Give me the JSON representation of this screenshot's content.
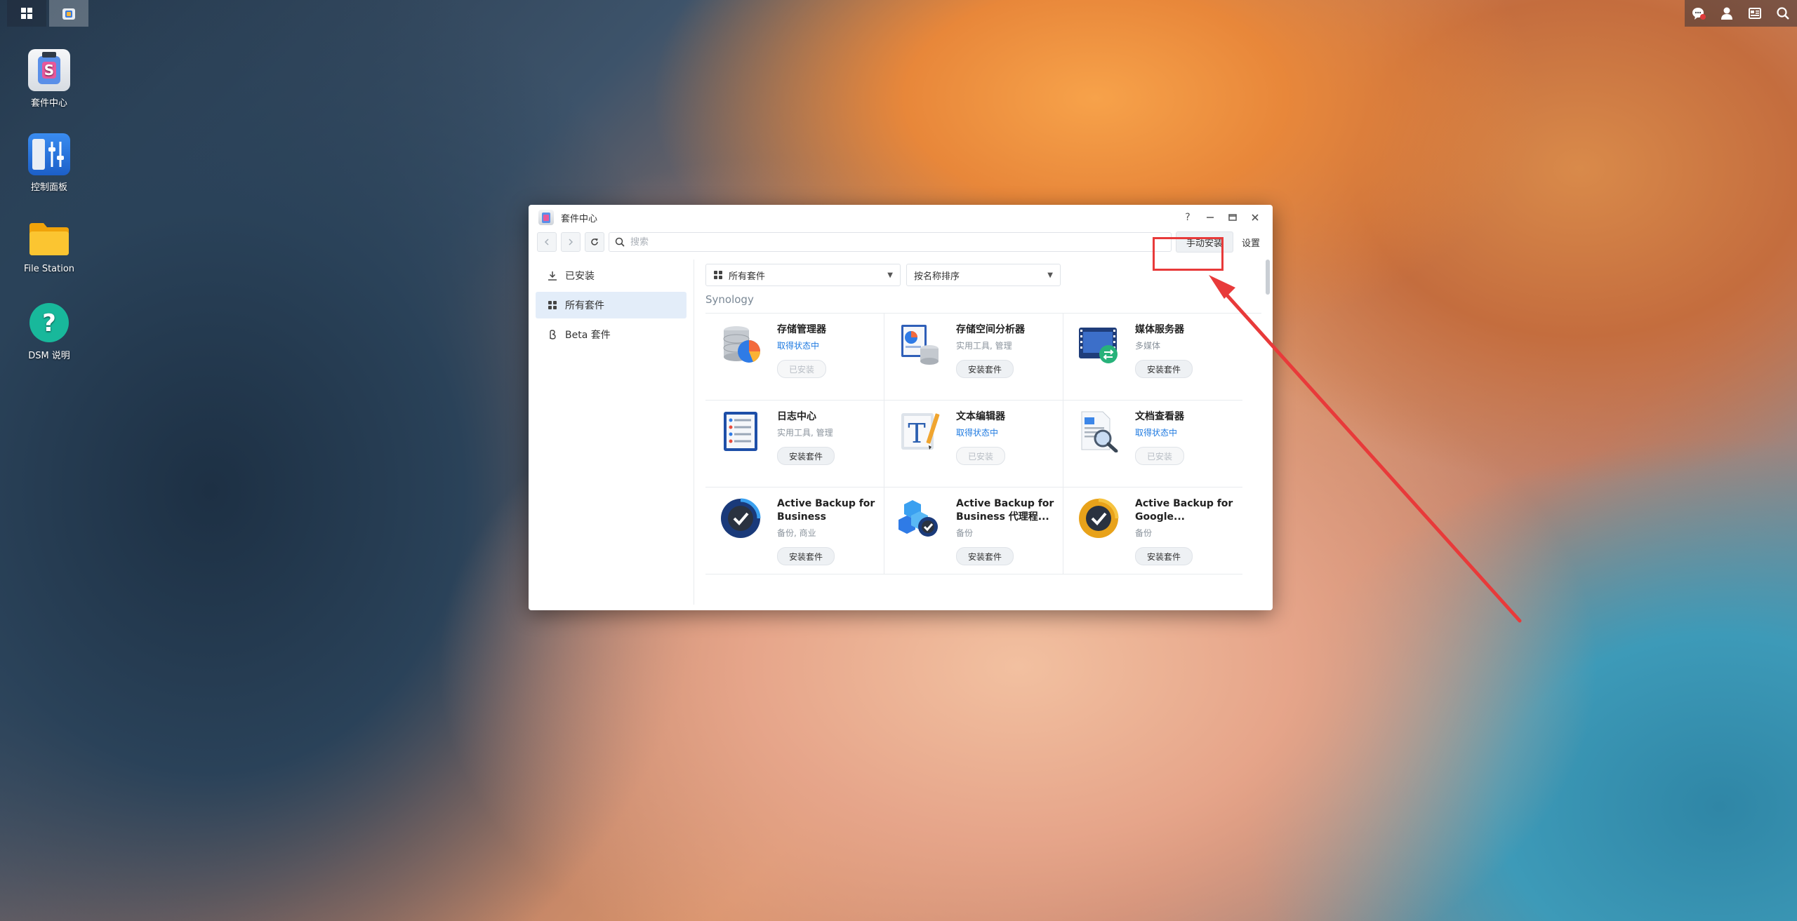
{
  "desktop": {
    "icons": [
      {
        "label": "套件中心"
      },
      {
        "label": "控制面板"
      },
      {
        "label": "File Station"
      },
      {
        "label": "DSM 说明"
      }
    ]
  },
  "window": {
    "title": "套件中心",
    "help": "?",
    "search_placeholder": "搜索",
    "manual_install": "手动安装",
    "settings": "设置",
    "sidebar": [
      {
        "label": "已安装"
      },
      {
        "label": "所有套件"
      },
      {
        "label": "Beta 套件"
      }
    ],
    "filter_category": "所有套件",
    "filter_sort": "按名称排序",
    "section": "Synology",
    "packages": [
      {
        "name": "存储管理器",
        "sub": "取得状态中",
        "sub_is_status": true,
        "button": "已安装",
        "disabled": true
      },
      {
        "name": "存储空间分析器",
        "sub": "实用工具, 管理",
        "sub_is_status": false,
        "button": "安装套件",
        "disabled": false
      },
      {
        "name": "媒体服务器",
        "sub": "多媒体",
        "sub_is_status": false,
        "button": "安装套件",
        "disabled": false
      },
      {
        "name": "日志中心",
        "sub": "实用工具, 管理",
        "sub_is_status": false,
        "button": "安装套件",
        "disabled": false
      },
      {
        "name": "文本编辑器",
        "sub": "取得状态中",
        "sub_is_status": true,
        "button": "已安装",
        "disabled": true
      },
      {
        "name": "文档查看器",
        "sub": "取得状态中",
        "sub_is_status": true,
        "button": "已安装",
        "disabled": true
      },
      {
        "name": "Active Backup for Business",
        "sub": "备份, 商业",
        "sub_is_status": false,
        "button": "安装套件",
        "disabled": false
      },
      {
        "name": "Active Backup for Business 代理程...",
        "sub": "备份",
        "sub_is_status": false,
        "button": "安装套件",
        "disabled": false
      },
      {
        "name": "Active Backup for Google...",
        "sub": "备份",
        "sub_is_status": false,
        "button": "安装套件",
        "disabled": false
      }
    ]
  },
  "colors": {
    "highlight": "#e83a3a",
    "status_text": "#1f7ae0",
    "sidebar_active": "#e3edf9"
  }
}
